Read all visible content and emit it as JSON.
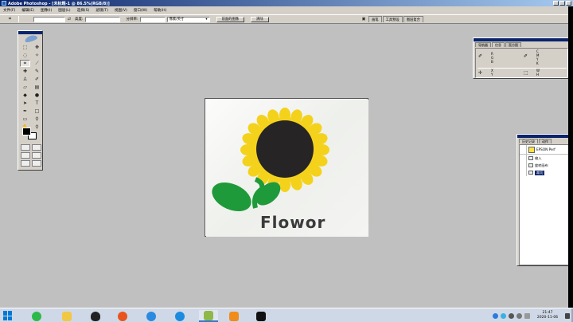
{
  "titlebar": {
    "title": "Adobe Photoshop - [未标题-1 @ 86.5%(RGB/8)]"
  },
  "menu": [
    {
      "label": "文件(F)"
    },
    {
      "label": "编辑(E)"
    },
    {
      "label": "图像(I)"
    },
    {
      "label": "图层(L)"
    },
    {
      "label": "选择(S)"
    },
    {
      "label": "滤镜(T)"
    },
    {
      "label": "视图(V)"
    },
    {
      "label": "窗口(W)"
    },
    {
      "label": "帮助(H)"
    }
  ],
  "options": {
    "width_label": "高度:",
    "resolution_label": "分辨率:",
    "mode_value": "像素/英寸",
    "front_image_button": "前面的图像",
    "clear_button": "清除"
  },
  "palette_well": {
    "tabs": [
      {
        "label": "画笔"
      },
      {
        "label": "工具预设"
      },
      {
        "label": "图层复合"
      }
    ]
  },
  "info_panel": {
    "tabs": [
      {
        "label": "导航器"
      },
      {
        "label": "信息"
      },
      {
        "label": "直方图"
      }
    ],
    "rgb_label": "R\nG\nB",
    "cmyk_label": "C\nM\nY\nK",
    "xy_label": "X\nY",
    "wh_label": "W\nH"
  },
  "canvas": {
    "text": "Flowor"
  },
  "history_panel": {
    "tabs": [
      {
        "label": "历史记录"
      },
      {
        "label": "动作"
      }
    ],
    "items": [
      {
        "label": "EPSON Perf",
        "snapshot": true
      },
      {
        "label": "输入"
      },
      {
        "label": "旋转画布"
      },
      {
        "label": "裁切",
        "selected": true
      }
    ]
  },
  "taskbar": {
    "time": "21:47",
    "date": "2020-11-06"
  },
  "colors": {
    "accent": "#0a246a",
    "petal": "#f4d21c",
    "center": "#262424",
    "leaf": "#1e9a3a"
  }
}
